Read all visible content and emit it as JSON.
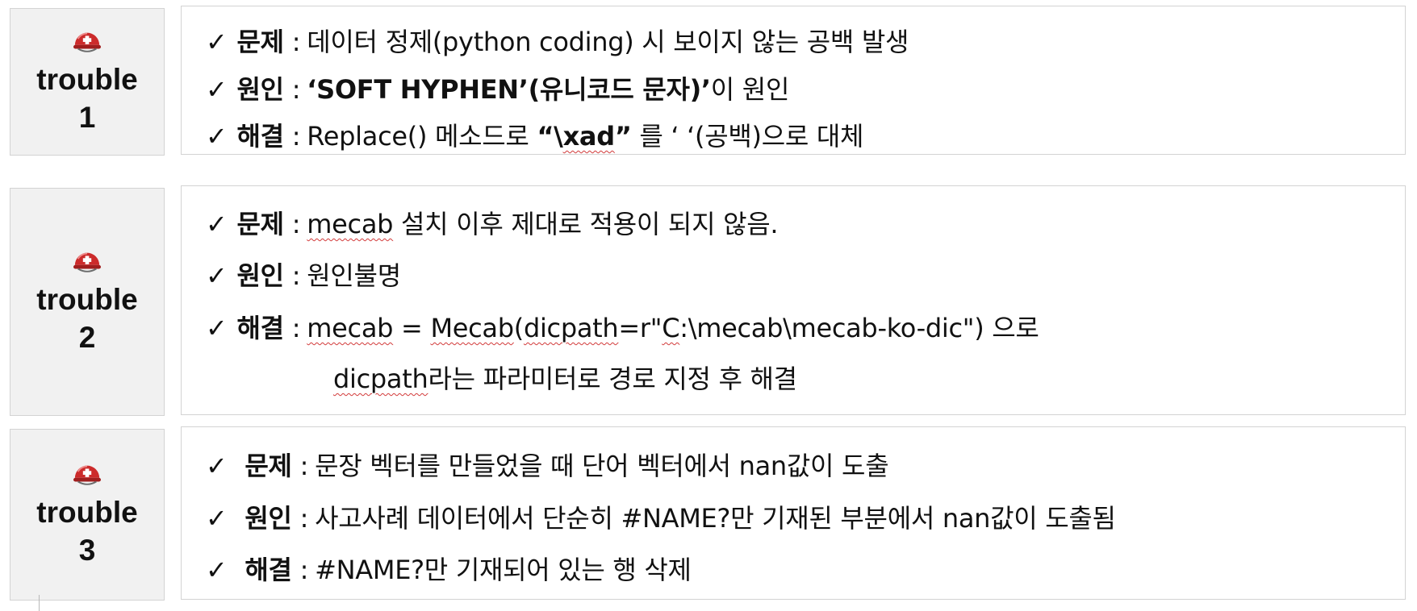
{
  "troubles": [
    {
      "label": "trouble",
      "number": "1",
      "problem_key": "문제",
      "problem_text": "데이터 정제(python coding) 시 보이지 않는 공백 발생",
      "cause_key": "원인",
      "cause_bold": "‘SOFT HYPHEN’(유니코드 문자)’",
      "cause_rest": "이 원인",
      "solution_key": "해결",
      "solution_a": "Replace() 메소드로 ",
      "solution_q1": "“\\",
      "solution_xad": "xad",
      "solution_q2": "”",
      "solution_b": " 를 ‘  ‘(공백)으로 대체"
    },
    {
      "label": "trouble",
      "number": "2",
      "problem_key": "문제",
      "problem_mecab": "mecab",
      "problem_rest": " 설치 이후 제대로 적용이 되지 않음.",
      "cause_key": "원인",
      "cause_text": "원인불명",
      "solution_key": "해결",
      "solution_mecab": "mecab",
      "solution_eq": " = ",
      "solution_Mecab": "Mecab",
      "solution_paren": "(",
      "solution_dicpath": "dicpath",
      "solution_r": "=r\"",
      "solution_C": "C",
      "solution_path": ":\\mecab\\mecab-ko-dic\") 으로",
      "solution2_dicpath": "dicpath",
      "solution2_rest": "라는 파라미터로 경로 지정 후 해결"
    },
    {
      "label": "trouble",
      "number": "3",
      "problem_key": "문제",
      "problem_text": "문장 벡터를 만들었을 때 단어 벡터에서 nan값이 도출",
      "cause_key": "원인",
      "cause_text": "사고사례 데이터에서 단순히 #NAME?만 기재된 부분에서 nan값이 도출됨",
      "solution_key": "해결",
      "solution_text": "#NAME?만 기재되어 있는 행 삭제"
    }
  ],
  "symbols": {
    "check": "✓",
    "colon": ":",
    "helmet_icon": "rescue-helmet-icon"
  },
  "colors": {
    "label_bg": "#f1f1f1",
    "border": "#d3d3d3",
    "helmet_red": "#cc2b2b",
    "squiggle": "#d23a3a"
  }
}
